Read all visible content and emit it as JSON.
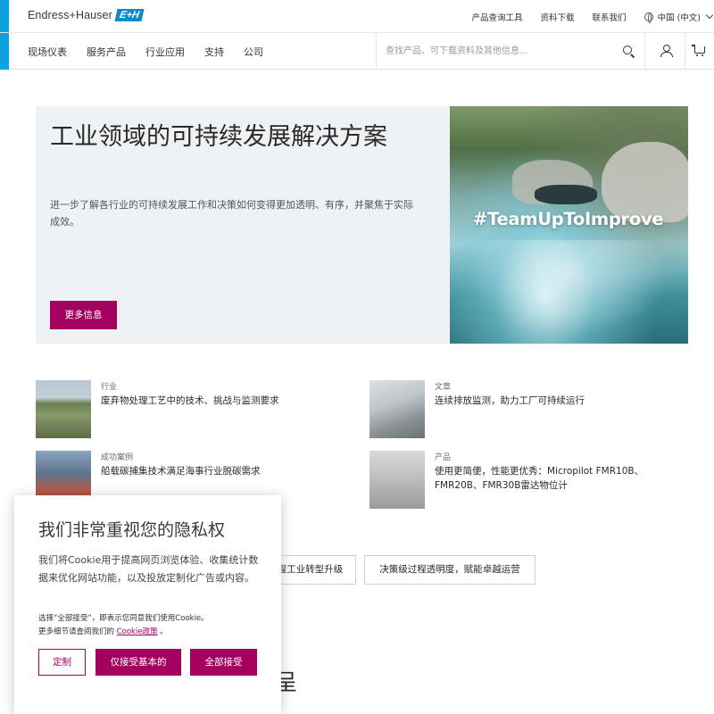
{
  "brand": {
    "name": "Endress+Hauser",
    "mark": "E+H",
    "accent": "#a3005f",
    "bar_color": "#0fa0e0"
  },
  "top_links": [
    "产品查询工具",
    "资料下载",
    "联系我们"
  ],
  "language": {
    "label": "中国 (中文)",
    "icon": "globe-icon"
  },
  "nav": [
    "现场仪表",
    "服务产品",
    "行业应用",
    "支持",
    "公司"
  ],
  "search": {
    "placeholder": "查找产品、可下载资料及其他信息..."
  },
  "hero": {
    "title": "工业领域的可持续发展解决方案",
    "description": "进一步了解各行业的可持续发展工作和决策如何变得更加透明、有序，并聚焦于实际成效。",
    "button": "更多信息",
    "image_caption": "#TeamUpToImprove"
  },
  "cards": [
    {
      "category": "行业",
      "title": "废弃物处理工艺中的技术、挑战与监测要求"
    },
    {
      "category": "文章",
      "title": "连续排放监测，助力工厂可持续运行"
    },
    {
      "category": "成功案例",
      "title": "船载碳捕集技术满足海事行业脱碳需求"
    },
    {
      "category": "产品",
      "title": "使用更简便，性能更优秀：Micropilot FMR10B、FMR20B、FMR30B雷达物位计"
    }
  ],
  "tags": [
    "程工业转型升级",
    "决策级过程透明度，赋能卓越运营"
  ],
  "partial_heading": "呈",
  "cookie": {
    "title": "我们非常重视您的隐私权",
    "text": "我们将Cookie用于提高网页浏览体验、收集统计数据来优化网站功能，以及投放定制化广告或内容。",
    "note_line1": "选择“全部接受”，即表示您同意我们使用Cookie。",
    "note_line2_prefix": "更多细节请查阅我们的",
    "note_link": "Cookie政策",
    "note_suffix": "。",
    "btn_customize": "定制",
    "btn_basic": "仅接受基本的",
    "btn_accept_all": "全部接受"
  }
}
